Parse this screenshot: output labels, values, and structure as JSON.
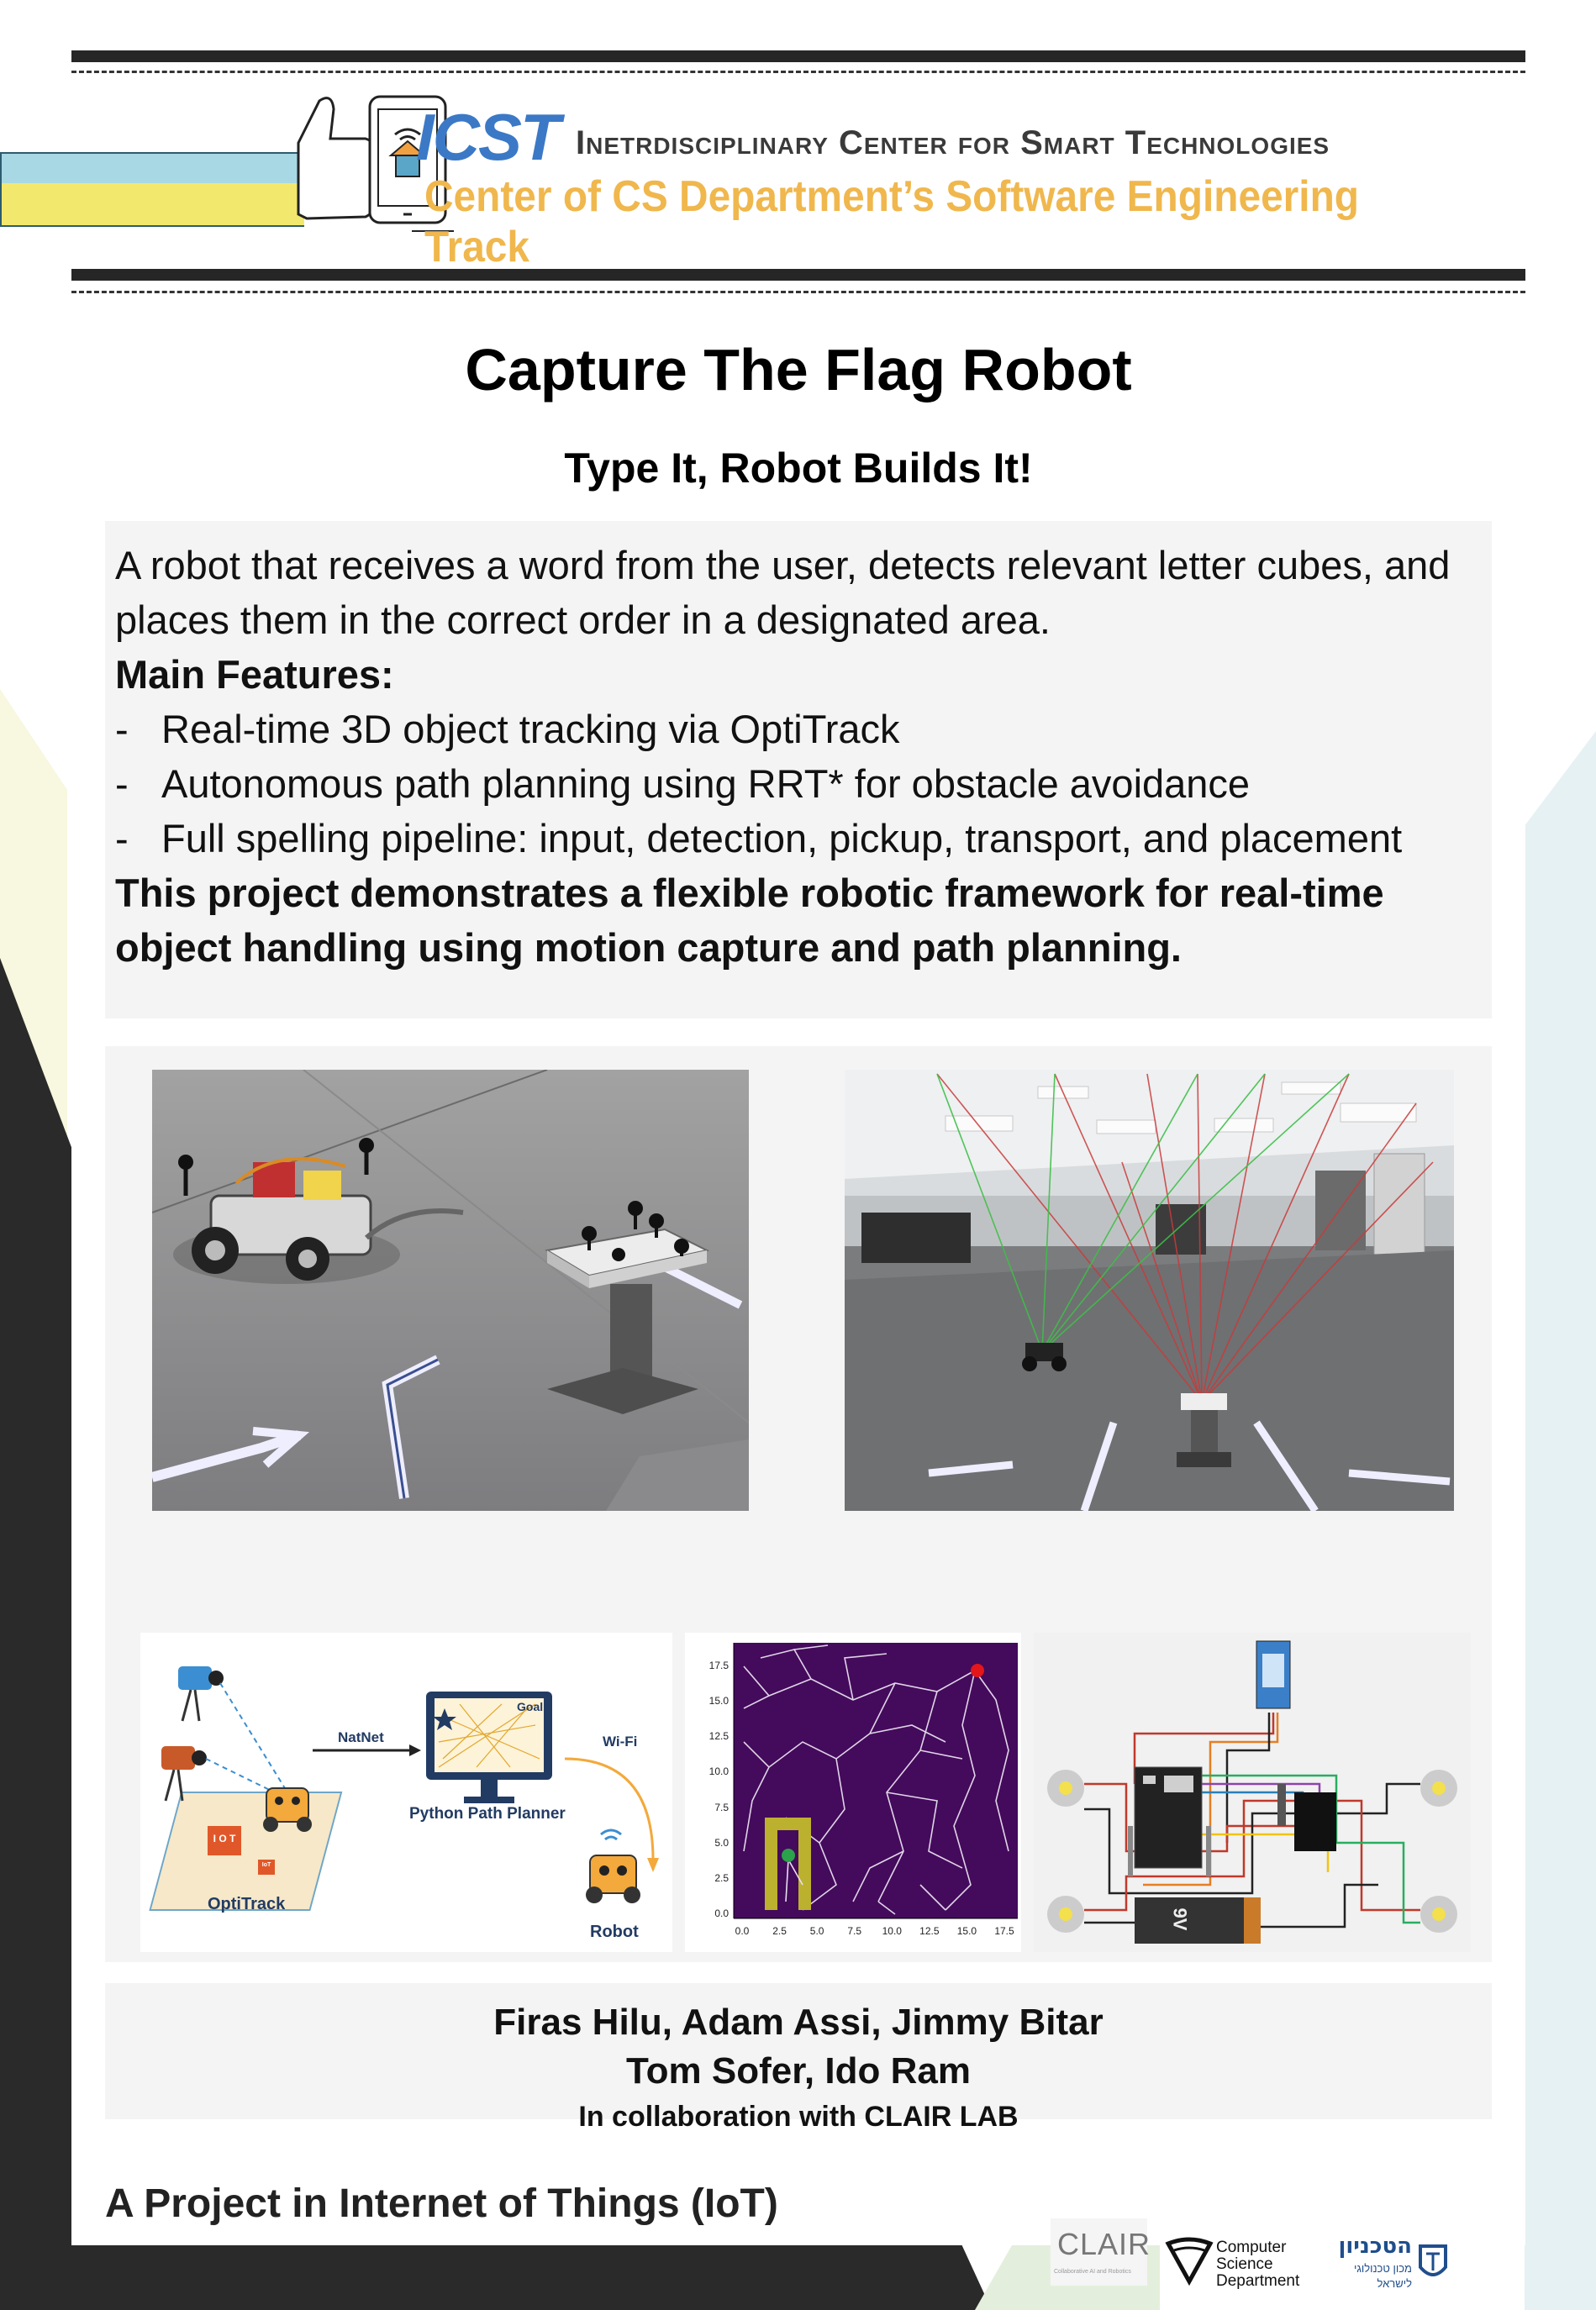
{
  "header": {
    "logo": "ICST",
    "title": "Inetrdisciplinary Center for Smart Technologies",
    "subtitle": "Center of CS Department’s Software Engineering Track"
  },
  "title": "Capture The Flag Robot",
  "subtitle": "Type It, Robot Builds It!",
  "description": {
    "intro": "A robot that receives a word from the user, detects relevant letter cubes, and places them in the correct order in a designated area.",
    "features_heading": "Main Features:",
    "features": [
      "Real-time 3D object tracking via OptiTrack",
      "Autonomous path planning using RRT* for obstacle avoidance",
      "Full spelling pipeline: input, detection, pickup, transport, and placement"
    ],
    "bullet_marker": "-",
    "conclusion": "This project demonstrates a flexible robotic framework for real-time object handling using motion capture and path planning."
  },
  "diagram": {
    "natnet": "NatNet",
    "wifi": "Wi-Fi",
    "goal": "Goal",
    "planner": "Python Path Planner",
    "optitrack": "OptiTrack",
    "robot": "Robot",
    "cube1": "I O T",
    "cube2": "IoT"
  },
  "rrt_plot": {
    "yticks": [
      "17.5",
      "15.0",
      "12.5",
      "10.0",
      "7.5",
      "5.0",
      "2.5",
      "0.0"
    ],
    "xticks": [
      "0.0",
      "2.5",
      "5.0",
      "7.5",
      "10.0",
      "12.5",
      "15.0",
      "17.5"
    ]
  },
  "circuit": {
    "battery_label": "9V"
  },
  "authors": {
    "line1": "Firas Hilu, Adam Assi, Jimmy Bitar",
    "line2": "Tom Sofer, Ido Ram",
    "collab": "In collaboration with CLAIR LAB"
  },
  "footer": "A Project in Internet of Things (IoT)",
  "logos": {
    "clair": "CLAIR",
    "clair_sub": "Collaborative AI and Robotics",
    "cs_line1": "Computer",
    "cs_line2": "Science",
    "cs_line3": "Department",
    "technion_he": "הטכניון",
    "technion_sub1": "מכון טכנולוגי",
    "technion_sub2": "לישראל"
  },
  "colors": {
    "icst_blue": "#3b79c6",
    "icst_orange": "#f0b74d",
    "panel_bg": "#f4f4f4",
    "rrt_bg": "#440a5c"
  }
}
